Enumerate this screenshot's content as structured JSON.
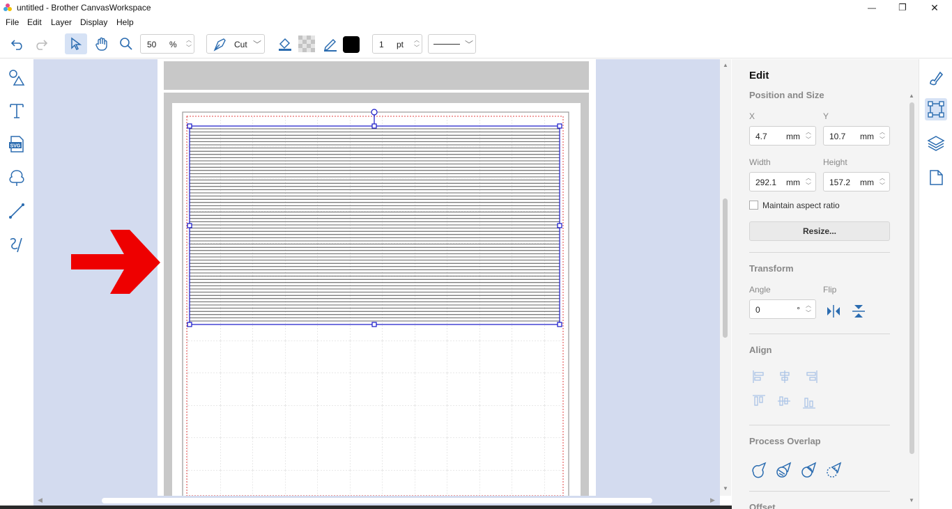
{
  "window": {
    "title": "untitled - Brother CanvasWorkspace",
    "minimize": "—",
    "restore": "❐",
    "close": "✕"
  },
  "menu": [
    "File",
    "Edit",
    "Layer",
    "Display",
    "Help"
  ],
  "toolbar": {
    "zoom_value": "50",
    "zoom_unit": "%",
    "mode_label": "Cut",
    "stroke_width_value": "1",
    "stroke_width_unit": "pt",
    "line_color": "#000000"
  },
  "panel": {
    "title": "Edit",
    "position_size": {
      "heading": "Position and Size",
      "x_label": "X",
      "x_value": "4.7",
      "x_unit": "mm",
      "y_label": "Y",
      "y_value": "10.7",
      "y_unit": "mm",
      "width_label": "Width",
      "width_value": "292.1",
      "width_unit": "mm",
      "height_label": "Height",
      "height_value": "157.2",
      "height_unit": "mm",
      "aspect_label": "Maintain aspect ratio",
      "resize_label": "Resize..."
    },
    "transform": {
      "heading": "Transform",
      "angle_label": "Angle",
      "angle_value": "0",
      "angle_unit": "°",
      "flip_label": "Flip"
    },
    "align": {
      "heading": "Align"
    },
    "overlap": {
      "heading": "Process Overlap"
    },
    "offset": {
      "heading": "Offset"
    }
  },
  "colors": {
    "accent": "#2b6cb0",
    "canvas_bg": "#d3dbef",
    "selection": "#1515c8",
    "arrow": "#ee0000"
  },
  "icons": {
    "left": [
      "shapes-icon",
      "text-icon",
      "svg-icon",
      "tracing-icon",
      "line-icon",
      "freehand-icon"
    ],
    "right": [
      "fill-brush-icon",
      "edit-transform-icon",
      "layers-icon",
      "page-icon"
    ]
  }
}
